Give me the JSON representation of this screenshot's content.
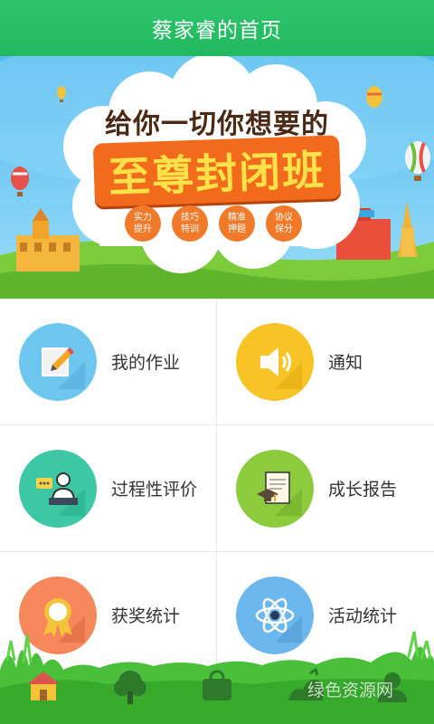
{
  "header": {
    "title": "蔡家睿的首页"
  },
  "banner": {
    "headline": "给你一切你想要的",
    "main_title": "至尊封闭班",
    "badges": [
      {
        "line1": "实力",
        "line2": "提升"
      },
      {
        "line1": "技巧",
        "line2": "特训"
      },
      {
        "line1": "精准",
        "line2": "押题"
      },
      {
        "line1": "协议",
        "line2": "保分"
      }
    ]
  },
  "menu": {
    "items": [
      {
        "label": "我的作业",
        "icon": "homework-icon",
        "color": "#6ec6ee"
      },
      {
        "label": "通知",
        "icon": "speaker-icon",
        "color": "#f7c325"
      },
      {
        "label": "过程性评价",
        "icon": "teacher-icon",
        "color": "#3cc8a4"
      },
      {
        "label": "成长报告",
        "icon": "certificate-icon",
        "color": "#8ccb3c"
      },
      {
        "label": "获奖统计",
        "icon": "medal-icon",
        "color": "#f5875a"
      },
      {
        "label": "活动统计",
        "icon": "atom-icon",
        "color": "#6cb7ee"
      }
    ]
  },
  "tabbar": {
    "tabs": [
      {
        "icon": "home-icon"
      },
      {
        "icon": "tree-icon"
      },
      {
        "icon": "bag-icon"
      },
      {
        "icon": "plant-icon"
      },
      {
        "icon": "profile-icon"
      }
    ]
  },
  "watermark": {
    "text": "绿色资源网"
  },
  "colors": {
    "header": "#2fc56c",
    "divider": "#e8e8e8",
    "banner_title": "#f26a1b"
  }
}
